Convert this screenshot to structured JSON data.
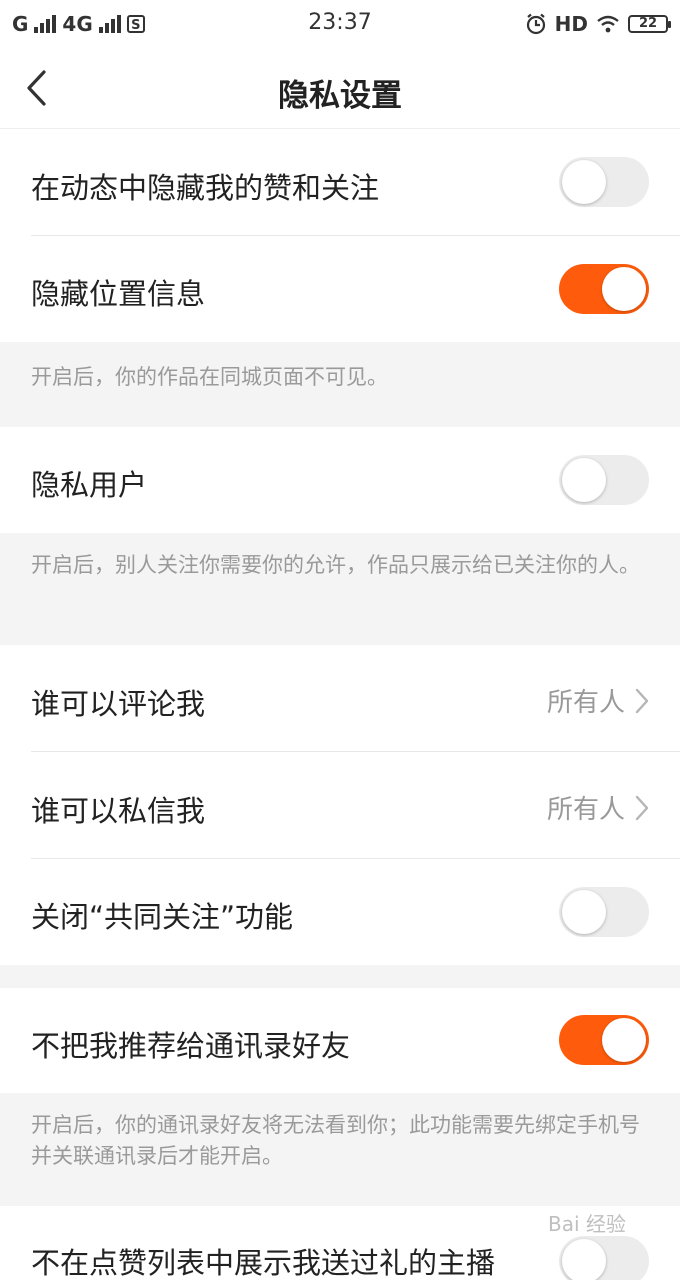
{
  "status_bar": {
    "carrier1": "G",
    "carrier2": "4G",
    "time": "23:37",
    "hd": "HD",
    "battery": "22"
  },
  "header": {
    "title": "隐私设置"
  },
  "settings": {
    "hide_likes": {
      "label": "在动态中隐藏我的赞和关注",
      "on": false
    },
    "hide_location": {
      "label": "隐藏位置信息",
      "on": true,
      "hint": "开启后，你的作品在同城页面不可见。"
    },
    "private_user": {
      "label": "隐私用户",
      "on": false,
      "hint": "开启后，别人关注你需要你的允许，作品只展示给已关注你的人。"
    },
    "who_comment": {
      "label": "谁可以评论我",
      "value": "所有人"
    },
    "who_message": {
      "label": "谁可以私信我",
      "value": "所有人"
    },
    "close_common_follow": {
      "label": "关闭“共同关注”功能",
      "on": false
    },
    "no_recommend_contacts": {
      "label": "不把我推荐给通讯录好友",
      "on": true,
      "hint": "开启后，你的通讯录好友将无法看到你；此功能需要先绑定手机号并关联通讯录后才能开启。"
    },
    "hide_gift_anchor": {
      "label": "不在点赞列表中展示我送过礼的主播",
      "on": false
    }
  },
  "colors": {
    "accent": "#fe5c0c",
    "toggle_off": "#ececec",
    "section_bg": "#f4f4f4"
  },
  "watermark": "Bai 经验"
}
